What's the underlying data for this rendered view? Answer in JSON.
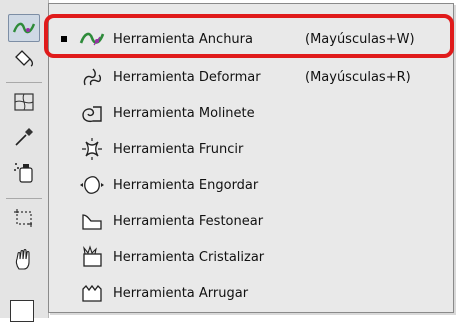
{
  "flyout": {
    "items": [
      {
        "label": "Herramienta Anchura",
        "shortcut": "(Mayúsculas+W)",
        "selected": true,
        "icon": "width-tool-icon"
      },
      {
        "label": "Herramienta Deformar",
        "shortcut": "(Mayúsculas+R)",
        "selected": false,
        "icon": "warp-tool-icon"
      },
      {
        "label": "Herramienta Molinete",
        "shortcut": "",
        "selected": false,
        "icon": "twirl-tool-icon"
      },
      {
        "label": "Herramienta Fruncir",
        "shortcut": "",
        "selected": false,
        "icon": "pucker-tool-icon"
      },
      {
        "label": "Herramienta Engordar",
        "shortcut": "",
        "selected": false,
        "icon": "bloat-tool-icon"
      },
      {
        "label": "Herramienta Festonear",
        "shortcut": "",
        "selected": false,
        "icon": "scallop-tool-icon"
      },
      {
        "label": "Herramienta Cristalizar",
        "shortcut": "",
        "selected": false,
        "icon": "crystallize-tool-icon"
      },
      {
        "label": "Herramienta Arrugar",
        "shortcut": "",
        "selected": false,
        "icon": "wrinkle-tool-icon"
      }
    ]
  },
  "colors": {
    "highlight": "#e01b1b",
    "menu_bg": "#e9e9e9",
    "width_tool_green": "#2e8b3a",
    "width_tool_purple": "#9b2fa8"
  }
}
